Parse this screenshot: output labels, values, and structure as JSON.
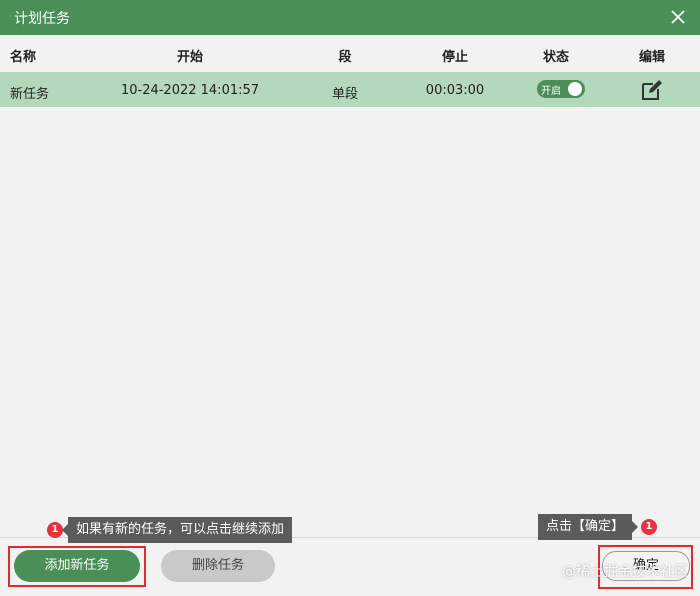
{
  "window": {
    "title": "计划任务",
    "close_icon": "close-icon"
  },
  "table": {
    "columns": [
      "名称",
      "开始",
      "段",
      "停止",
      "状态",
      "编辑"
    ],
    "rows": [
      {
        "name": "新任务",
        "start": "10-24-2022 14:01:57",
        "segment": "单段",
        "stop": "00:03:00",
        "status_label": "开启",
        "status_on": true,
        "edit_icon": "edit-icon"
      }
    ]
  },
  "tooltips": {
    "left_badge": "1",
    "left_text": "如果有新的任务，可以点击继续添加",
    "right_text": "点击【确定】",
    "right_badge": "1"
  },
  "buttons": {
    "add": "添加新任务",
    "delete": "删除任务",
    "ok": "确定"
  },
  "watermark": "@稀土掘金技术社区",
  "colors": {
    "primary": "#4a8f57",
    "row_selected": "#b4d8bb",
    "highlight": "#e02b2b",
    "badge": "#e8323c"
  }
}
